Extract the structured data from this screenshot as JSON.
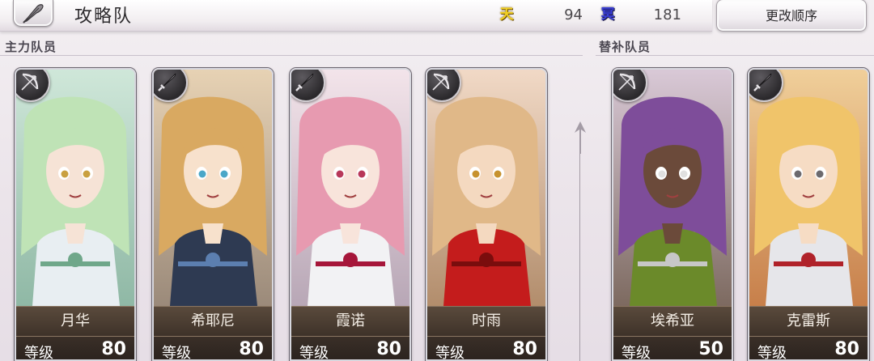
{
  "header": {
    "team_title": "攻略队",
    "resources": {
      "sky_glyph": "天",
      "sky_value": "94",
      "dark_glyph": "冥",
      "dark_value": "181"
    },
    "change_order_label": "更改顺序"
  },
  "sections": {
    "main_label": "主力队员",
    "reserve_label": "替补队员"
  },
  "level_label": "等级",
  "main_members": [
    {
      "name": "月华",
      "level": "80",
      "weapon": "bow-icon",
      "palette": "mint"
    },
    {
      "name": "希耶尼",
      "level": "80",
      "weapon": "sword-icon",
      "palette": "blonde"
    },
    {
      "name": "霞诺",
      "level": "80",
      "weapon": "sword-icon",
      "palette": "pink"
    },
    {
      "name": "时雨",
      "level": "80",
      "weapon": "bow-icon",
      "palette": "red"
    }
  ],
  "reserve_members": [
    {
      "name": "埃希亚",
      "level": "50",
      "weapon": "bow-icon",
      "palette": "purple"
    },
    {
      "name": "克雷斯",
      "level": "80",
      "weapon": "sword-icon",
      "palette": "silver"
    }
  ],
  "colors": {
    "sky_resource": "#f2d024",
    "dark_resource": "#3b3fd8",
    "plate_brown": "#3e3229"
  }
}
